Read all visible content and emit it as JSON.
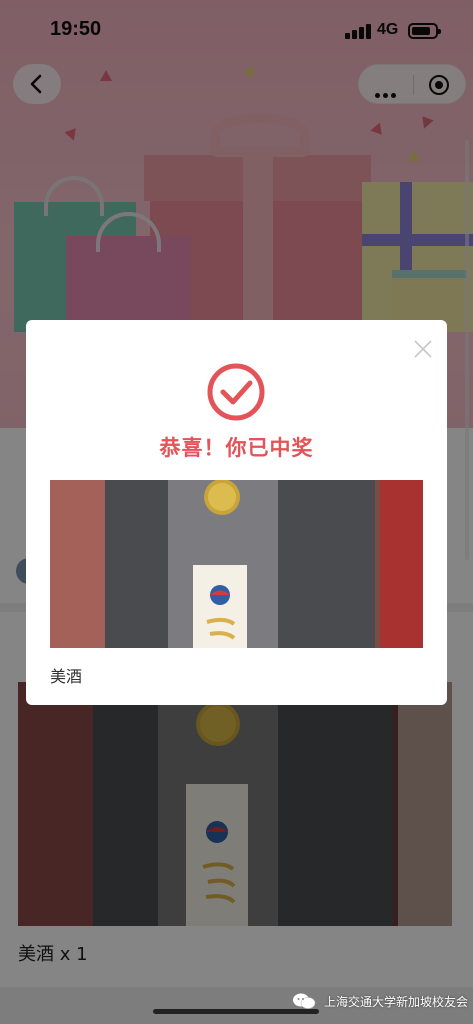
{
  "status": {
    "time": "19:50",
    "network": "4G"
  },
  "nav": {
    "back_icon": "chevron-left-icon",
    "menu_icon": "more-dots-icon",
    "close_icon": "target-circle-icon"
  },
  "background": {
    "title_partial": "",
    "section_label_partial": "",
    "prize_quantity": "美酒 x 1"
  },
  "modal": {
    "title": "恭喜！你已中奖",
    "prize_name": "美酒",
    "colors": {
      "accent": "#e35357"
    }
  },
  "watermark": {
    "text": "上海交通大学新加坡校友会"
  }
}
